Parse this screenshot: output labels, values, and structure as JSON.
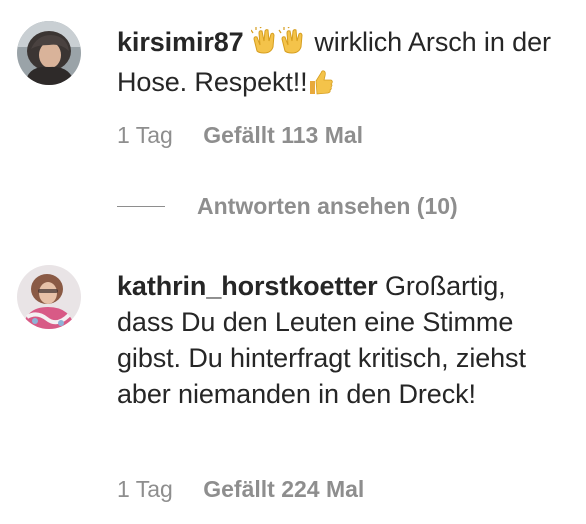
{
  "comments": [
    {
      "username": "kirsimir87",
      "text_before_emoji": " ",
      "emoji_clap": "clapping-hands-icon",
      "text": " wirklich Arsch in der Hose. Respekt!!",
      "emoji_end": "thumbs-up-icon",
      "time": "1 Tag",
      "likes": "Gefällt 113 Mal",
      "replies_label": "Antworten ansehen (10)"
    },
    {
      "username": "kathrin_horstkoetter",
      "text": " Großartig, dass Du den Leuten eine Stimme gibst. Du hinterfragt kritisch, ziehst aber niemanden in den Dreck!",
      "time": "1 Tag",
      "likes": "Gefällt 224 Mal"
    }
  ],
  "colors": {
    "text": "#262626",
    "muted": "#8e8e8e",
    "background": "#ffffff"
  }
}
